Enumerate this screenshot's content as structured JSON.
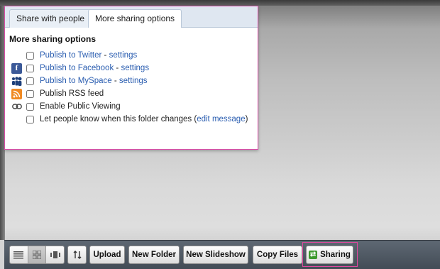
{
  "tabs": [
    {
      "label": "Share with people"
    },
    {
      "label": "More sharing options"
    }
  ],
  "section_title": "More sharing options",
  "options": [
    {
      "icon": "twitter-icon",
      "text": "Publish to Twitter",
      "separator": " - ",
      "link": "settings"
    },
    {
      "icon": "facebook-icon",
      "text": "Publish to Facebook",
      "separator": " - ",
      "link": "settings"
    },
    {
      "icon": "myspace-icon",
      "text": "Publish to MySpace",
      "separator": " - ",
      "link": "settings"
    },
    {
      "icon": "rss-icon",
      "text": "Publish RSS feed"
    },
    {
      "icon": "link-icon",
      "text": "Enable Public Viewing"
    },
    {
      "icon": "sync-icon",
      "text": "Let people know when this folder changes (",
      "link": "edit message",
      "suffix": ")"
    }
  ],
  "toolbar": {
    "upload": "Upload",
    "new_folder": "New Folder",
    "new_slideshow": "New Slideshow",
    "copy_files": "Copy Files",
    "sharing": "Sharing"
  },
  "colors": {
    "link": "#2a5db0",
    "highlight_outline": "#e0489f",
    "sharing_icon": "#3d9a2e"
  }
}
